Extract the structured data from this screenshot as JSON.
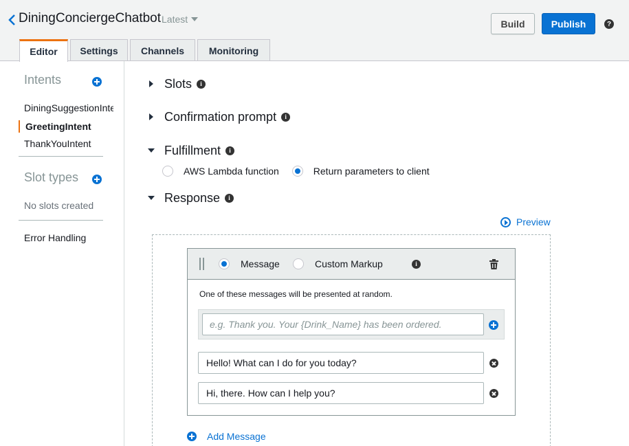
{
  "header": {
    "bot_name": "DiningConciergeChatbot",
    "version": "Latest",
    "build_label": "Build",
    "publish_label": "Publish",
    "help_glyph": "?"
  },
  "tabs": [
    {
      "label": "Editor",
      "active": true
    },
    {
      "label": "Settings",
      "active": false
    },
    {
      "label": "Channels",
      "active": false
    },
    {
      "label": "Monitoring",
      "active": false
    }
  ],
  "sidebar": {
    "intents_heading": "Intents",
    "intents": [
      {
        "label": "DiningSuggestionIntent",
        "active": false
      },
      {
        "label": "GreetingIntent",
        "active": true
      },
      {
        "label": "ThankYouIntent",
        "active": false
      }
    ],
    "slot_types_heading": "Slot types",
    "slot_types_empty": "No slots created",
    "error_handling": "Error Handling"
  },
  "sections": {
    "slots": "Slots",
    "confirmation": "Confirmation prompt",
    "fulfillment": "Fulfillment",
    "response": "Response"
  },
  "fulfillment": {
    "options": [
      "AWS Lambda function",
      "Return parameters to client"
    ],
    "selected": "Return parameters to client"
  },
  "response": {
    "preview_label": "Preview",
    "type_options": [
      "Message",
      "Custom Markup"
    ],
    "selected_type": "Message",
    "random_note": "One of these messages will be presented at random.",
    "input_placeholder": "e.g. Thank you. Your {Drink_Name} has been ordered.",
    "messages": [
      "Hello! What can I do for you today?",
      "Hi, there. How can I help you?"
    ],
    "add_message_label": "Add Message"
  },
  "colors": {
    "accent_blue": "#0972d3",
    "active_tab_orange": "#ec7211"
  }
}
